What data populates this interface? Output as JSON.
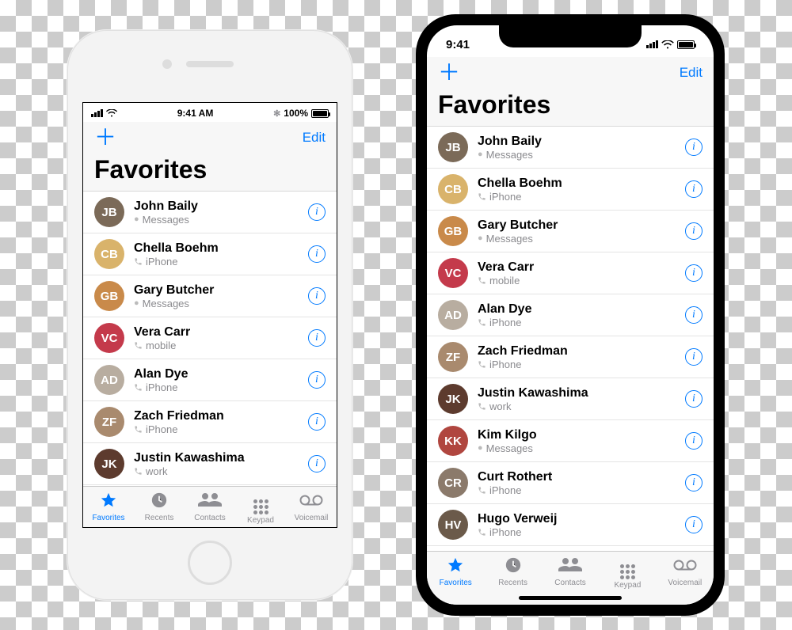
{
  "status8": {
    "time": "9:41 AM",
    "battery": "100%"
  },
  "statusX": {
    "time": "9:41"
  },
  "nav": {
    "add": "＋",
    "edit": "Edit",
    "title": "Favorites"
  },
  "contacts": [
    {
      "name": "John Baily",
      "sub": "Messages",
      "type": "msg",
      "color": "#7b6a58"
    },
    {
      "name": "Chella Boehm",
      "sub": "iPhone",
      "type": "call",
      "color": "#d9b36b"
    },
    {
      "name": "Gary Butcher",
      "sub": "Messages",
      "type": "msg",
      "color": "#c98a4a"
    },
    {
      "name": "Vera Carr",
      "sub": "mobile",
      "type": "call",
      "color": "#c43a4b"
    },
    {
      "name": "Alan Dye",
      "sub": "iPhone",
      "type": "call",
      "color": "#b8ada0"
    },
    {
      "name": "Zach Friedman",
      "sub": "iPhone",
      "type": "call",
      "color": "#a98a6e"
    },
    {
      "name": "Justin Kawashima",
      "sub": "work",
      "type": "call",
      "color": "#5d3b2e"
    },
    {
      "name": "Kim Kilgo",
      "sub": "Messages",
      "type": "msg",
      "color": "#b0463f"
    },
    {
      "name": "Curt Rothert",
      "sub": "iPhone",
      "type": "call",
      "color": "#8b7a6b"
    },
    {
      "name": "Hugo Verweij",
      "sub": "iPhone",
      "type": "call",
      "color": "#6b5a4a"
    }
  ],
  "limits": {
    "i8": 9,
    "ix": 10
  },
  "tabs": [
    {
      "key": "favorites",
      "label": "Favorites"
    },
    {
      "key": "recents",
      "label": "Recents"
    },
    {
      "key": "contacts",
      "label": "Contacts"
    },
    {
      "key": "keypad",
      "label": "Keypad"
    },
    {
      "key": "voicemail",
      "label": "Voicemail"
    }
  ]
}
